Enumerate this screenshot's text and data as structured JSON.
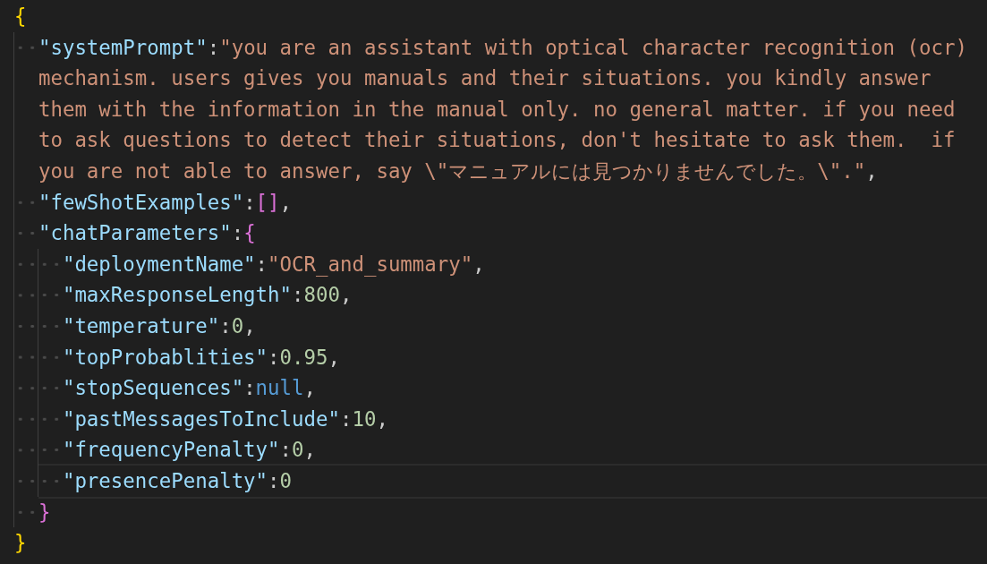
{
  "editor": {
    "open": [
      {
        "kind": "bracket",
        "text": "{",
        "color": "#ffd700"
      }
    ],
    "children": [
      {
        "wrap": true,
        "current": false,
        "tokens": [
          {
            "kind": "key",
            "text": "\"systemPrompt\""
          },
          {
            "kind": "punct",
            "text": ":"
          },
          {
            "kind": "string",
            "text": "\"you are an assistant with optical character recognition (ocr) mechanism. users gives you manuals and their situations. you kindly answer them with the information in the manual only. no general matter. if you need to ask questions to detect their situations, don't hesitate to ask them.  if you are not able to answer, say \\\"マニュアルには見つかりませんでした。\\\".\""
          },
          {
            "kind": "punct",
            "text": ","
          }
        ]
      },
      {
        "wrap": false,
        "current": false,
        "tokens": [
          {
            "kind": "key",
            "text": "\"fewShotExamples\""
          },
          {
            "kind": "punct",
            "text": ":"
          },
          {
            "kind": "bracket",
            "text": "[]",
            "color": "#da70d6"
          },
          {
            "kind": "punct",
            "text": ","
          }
        ]
      },
      {
        "wrap": false,
        "current": false,
        "tokens": [
          {
            "kind": "key",
            "text": "\"chatParameters\""
          },
          {
            "kind": "punct",
            "text": ":"
          },
          {
            "kind": "bracket",
            "text": "{",
            "color": "#da70d6"
          }
        ],
        "children": [
          {
            "wrap": false,
            "current": false,
            "tokens": [
              {
                "kind": "key",
                "text": "\"deploymentName\""
              },
              {
                "kind": "punct",
                "text": ":"
              },
              {
                "kind": "string",
                "text": "\"OCR_and_summary\""
              },
              {
                "kind": "punct",
                "text": ","
              }
            ]
          },
          {
            "wrap": false,
            "current": false,
            "tokens": [
              {
                "kind": "key",
                "text": "\"maxResponseLength\""
              },
              {
                "kind": "punct",
                "text": ":"
              },
              {
                "kind": "number",
                "text": "800"
              },
              {
                "kind": "punct",
                "text": ","
              }
            ]
          },
          {
            "wrap": false,
            "current": false,
            "tokens": [
              {
                "kind": "key",
                "text": "\"temperature\""
              },
              {
                "kind": "punct",
                "text": ":"
              },
              {
                "kind": "number",
                "text": "0"
              },
              {
                "kind": "punct",
                "text": ","
              }
            ]
          },
          {
            "wrap": false,
            "current": false,
            "tokens": [
              {
                "kind": "key",
                "text": "\"topProbablities\""
              },
              {
                "kind": "punct",
                "text": ":"
              },
              {
                "kind": "number",
                "text": "0.95"
              },
              {
                "kind": "punct",
                "text": ","
              }
            ]
          },
          {
            "wrap": false,
            "current": false,
            "tokens": [
              {
                "kind": "key",
                "text": "\"stopSequences\""
              },
              {
                "kind": "punct",
                "text": ":"
              },
              {
                "kind": "keyword",
                "text": "null"
              },
              {
                "kind": "punct",
                "text": ","
              }
            ]
          },
          {
            "wrap": false,
            "current": false,
            "tokens": [
              {
                "kind": "key",
                "text": "\"pastMessagesToInclude\""
              },
              {
                "kind": "punct",
                "text": ":"
              },
              {
                "kind": "number",
                "text": "10"
              },
              {
                "kind": "punct",
                "text": ","
              }
            ]
          },
          {
            "wrap": false,
            "current": false,
            "tokens": [
              {
                "kind": "key",
                "text": "\"frequencyPenalty\""
              },
              {
                "kind": "punct",
                "text": ":"
              },
              {
                "kind": "number",
                "text": "0"
              },
              {
                "kind": "punct",
                "text": ","
              }
            ]
          },
          {
            "wrap": false,
            "current": true,
            "tokens": [
              {
                "kind": "key",
                "text": "\"presencePenalty\""
              },
              {
                "kind": "punct",
                "text": ":"
              },
              {
                "kind": "number",
                "text": "0"
              }
            ]
          }
        ],
        "close": [
          {
            "kind": "bracket",
            "text": "}",
            "color": "#da70d6"
          }
        ]
      }
    ],
    "close": [
      {
        "kind": "bracket",
        "text": "}",
        "color": "#ffd700"
      }
    ]
  }
}
